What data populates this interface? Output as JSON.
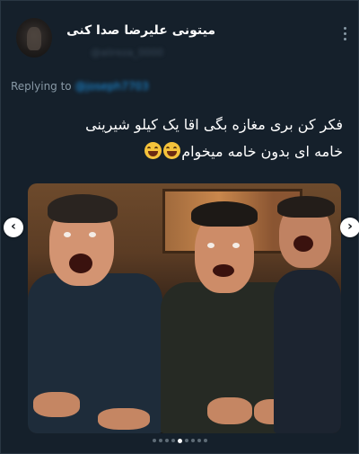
{
  "tweet": {
    "display_name": "میتونی علیرضا صدا کنی",
    "handle": "@alireza_0000",
    "replying_to_label": "Replying to",
    "replying_to_handle": "@joseph7703",
    "text_line_1": "فکر کن بری مغازه بگی اقا یک کیلو شیرینی",
    "text_line_2": "خامه ای بدون خامه میخوام",
    "emoji_count": 2,
    "more_icon": "more-vertical-icon"
  },
  "media": {
    "prev_icon": "‹",
    "next_icon": "›",
    "carousel_total": 9,
    "carousel_active_index": 4
  },
  "colors": {
    "background": "#15202b",
    "text": "#ffffff",
    "secondary": "#8899a6",
    "link": "#1d9bf0"
  }
}
